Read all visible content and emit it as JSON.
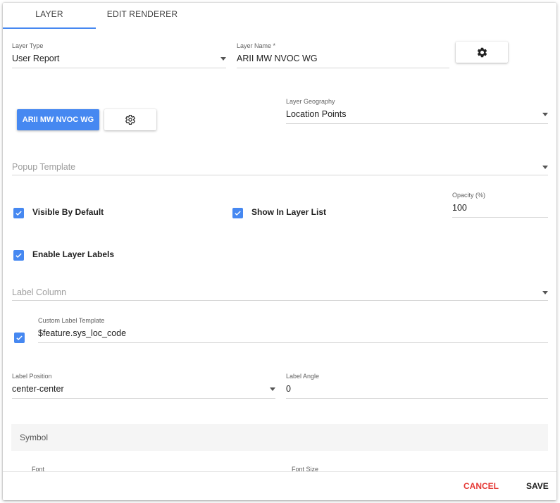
{
  "tabs": [
    {
      "label": "LAYER",
      "active": true
    },
    {
      "label": "EDIT RENDERER",
      "active": false
    }
  ],
  "layer_type": {
    "label": "Layer Type",
    "value": "User Report"
  },
  "layer_name": {
    "label": "Layer Name *",
    "value": "ARII MW NVOC WG"
  },
  "layer_button": {
    "label": "ARII MW NVOC WG"
  },
  "layer_geography": {
    "label": "Layer Geography",
    "value": "Location Points"
  },
  "popup_template": {
    "placeholder": "Popup Template"
  },
  "visible_by_default": {
    "label": "Visible By Default",
    "checked": true
  },
  "show_in_layer_list": {
    "label": "Show In Layer List",
    "checked": true
  },
  "opacity": {
    "label": "Opacity (%)",
    "value": "100"
  },
  "enable_layer_labels": {
    "label": "Enable Layer Labels",
    "checked": true
  },
  "label_column": {
    "placeholder": "Label Column"
  },
  "custom_label_template": {
    "label": "Custom Label Template",
    "value": "$feature.sys_loc_code",
    "checked": true
  },
  "label_position": {
    "label": "Label Position",
    "value": "center-center"
  },
  "label_angle": {
    "label": "Label Angle",
    "value": "0"
  },
  "symbol_section": {
    "title": "Symbol"
  },
  "font": {
    "label": "Font"
  },
  "font_size": {
    "label": "Font Size"
  },
  "footer": {
    "cancel": "CANCEL",
    "save": "SAVE"
  },
  "colors": {
    "accent": "#4688f1",
    "cancel": "#e53935"
  }
}
